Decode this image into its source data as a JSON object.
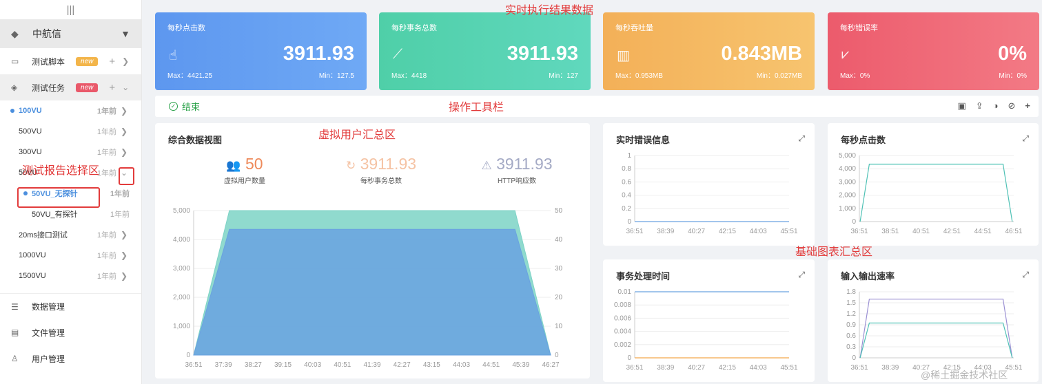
{
  "sidebar": {
    "org": "中航信",
    "menus": [
      {
        "label": "测试脚本",
        "badge": "new",
        "badge_color": "#f3b54a"
      },
      {
        "label": "测试任务",
        "badge": "new",
        "badge_color": "#e9596a"
      }
    ],
    "tasks": [
      {
        "label": "100VU",
        "time": "1年前"
      },
      {
        "label": "500VU",
        "time": "1年前"
      },
      {
        "label": "300VU",
        "time": "1年前"
      },
      {
        "label": "50VU",
        "time": "1年前"
      },
      {
        "label": "20ms接口测试",
        "time": "1年前"
      },
      {
        "label": "1000VU",
        "time": "1年前"
      },
      {
        "label": "1500VU",
        "time": "1年前"
      }
    ],
    "reports": [
      {
        "label": "50VU_无探针",
        "time": "1年前"
      },
      {
        "label": "50VU_有探针",
        "time": "1年前"
      }
    ],
    "bottom": [
      {
        "label": "数据管理"
      },
      {
        "label": "文件管理"
      },
      {
        "label": "用户管理"
      }
    ]
  },
  "annotations": {
    "top": "实时执行结果数据",
    "toolbar": "操作工具栏",
    "vu": "虚拟用户汇总区",
    "report": "测试报告选择区",
    "charts": "基础图表汇总区"
  },
  "cards": [
    {
      "title": "每秒点击数",
      "value": "3911.93",
      "max": "Max：4421.25",
      "min": "Min：127.5",
      "color": "#5b9cf0",
      "icon": "pointer-icon"
    },
    {
      "title": "每秒事务总数",
      "value": "3911.93",
      "max": "Max：4418",
      "min": "Min：127",
      "color": "#4fd1ad",
      "icon": "trend-icon"
    },
    {
      "title": "每秒吞吐量",
      "value": "0.843MB",
      "max": "Max：0.953MB",
      "min": "Min：0.027MB",
      "color": "#f5b55c",
      "icon": "bar-icon"
    },
    {
      "title": "每秒错误率",
      "value": "0%",
      "max": "Max：0%",
      "min": "Min：0%",
      "color": "#ee6272",
      "icon": "area-icon"
    }
  ],
  "toolbar": {
    "status": "结束"
  },
  "overview": {
    "title": "综合数据视图",
    "users_value": "50",
    "users_label": "虚拟用户数量",
    "tps_value": "3911.93",
    "tps_label": "每秒事务总数",
    "http_value": "3911.93",
    "http_label": "HTTP响应数"
  },
  "panels": {
    "errors": "实时错误信息",
    "hits": "每秒点击数",
    "trans_time": "事务处理时间",
    "io": "输入输出速率"
  },
  "watermark": "@稀土掘金技术社区",
  "chart_data": [
    {
      "type": "area",
      "title": "综合数据视图",
      "x": [
        "36:51",
        "37:39",
        "38:27",
        "39:15",
        "40:03",
        "40:51",
        "41:39",
        "42:27",
        "43:15",
        "44:03",
        "44:51",
        "45:39",
        "46:27"
      ],
      "ylim_left": [
        0,
        5000
      ],
      "yticks_left": [
        0,
        1000,
        2000,
        3000,
        4000,
        5000
      ],
      "ylim_right": [
        0,
        50
      ],
      "yticks_right": [
        0,
        10,
        20,
        30,
        40,
        50
      ],
      "series": [
        {
          "values": [
            0,
            5000,
            5000,
            5000,
            5000,
            5000,
            5000,
            5000,
            5000,
            5000,
            5000,
            5000,
            0
          ],
          "axis": "right_scaled",
          "color": "#7dd3c6"
        },
        {
          "values": [
            0,
            4350,
            4350,
            4350,
            4350,
            4350,
            4350,
            4350,
            4350,
            4350,
            4350,
            4350,
            0
          ],
          "axis": "left",
          "color": "#6aa2e0"
        }
      ]
    },
    {
      "type": "line",
      "title": "实时错误信息",
      "x": [
        "36:51",
        "38:39",
        "40:27",
        "42:15",
        "44:03",
        "45:51"
      ],
      "ylim": [
        0,
        1
      ],
      "yticks": [
        0,
        0.2,
        0.4,
        0.6,
        0.8,
        1
      ],
      "series": [
        {
          "values": [
            0,
            0,
            0,
            0,
            0,
            0
          ],
          "color": "#6aa2e0"
        }
      ]
    },
    {
      "type": "line",
      "title": "每秒点击数",
      "x": [
        "36:51",
        "38:51",
        "40:51",
        "42:51",
        "44:51",
        "46:51"
      ],
      "ylim": [
        0,
        5000
      ],
      "yticks": [
        0,
        1000,
        2000,
        3000,
        4000,
        5000
      ],
      "series": [
        {
          "values": [
            0,
            4350,
            4350,
            4350,
            4350,
            4350,
            4350,
            0
          ],
          "color": "#4fc1b5"
        }
      ]
    },
    {
      "type": "line",
      "title": "事务处理时间",
      "x": [
        "36:51",
        "38:39",
        "40:27",
        "42:15",
        "44:03",
        "45:51"
      ],
      "ylim": [
        0,
        0.01
      ],
      "yticks": [
        0,
        0.002,
        0.004,
        0.006,
        0.008,
        0.01
      ],
      "series": [
        {
          "values": [
            0.01,
            0.01,
            0.01,
            0.01,
            0.01,
            0.01
          ],
          "color": "#6aa2e0"
        },
        {
          "values": [
            0,
            0,
            0,
            0,
            0,
            0
          ],
          "color": "#f3a64a"
        }
      ]
    },
    {
      "type": "line",
      "title": "输入输出速率",
      "x": [
        "36:51",
        "38:39",
        "40:27",
        "42:15",
        "44:03",
        "45:51"
      ],
      "ylim": [
        0,
        1.8
      ],
      "yticks": [
        0,
        0.3,
        0.6,
        0.9,
        1.2,
        1.5,
        1.8
      ],
      "series": [
        {
          "values": [
            0,
            1.6,
            1.6,
            1.6,
            1.6,
            1.6,
            1.6,
            0
          ],
          "color": "#9a8fd3"
        },
        {
          "values": [
            0,
            0.95,
            0.95,
            0.95,
            0.95,
            0.95,
            0.95,
            0
          ],
          "color": "#4fc1b5"
        }
      ]
    }
  ]
}
